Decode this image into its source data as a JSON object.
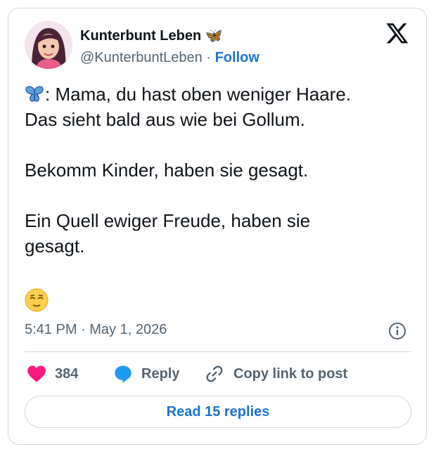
{
  "author": {
    "name": "Kunterbunt Leben 🦋",
    "handle": "@KunterbuntLeben",
    "follow_label": "Follow",
    "separator": "·"
  },
  "post": {
    "lines": [
      ": Mama, du hast oben weniger Haare.",
      "Das sieht bald aus wie bei Gollum.",
      "Bekomm Kinder, haben sie gesagt.",
      "Ein Quell ewiger Freude, haben sie",
      "gesagt."
    ],
    "prefix_icon": "butterfly-emoji",
    "emoji": "relieved-face-emoji",
    "timestamp": "5:41 PM · May 1, 2026"
  },
  "actions": {
    "likes_count": "384",
    "reply_label": "Reply",
    "copy_label": "Copy link to post"
  },
  "read_replies_label": "Read 15 replies",
  "colors": {
    "accent": "#1d72c9",
    "like": "#f91880",
    "muted": "#536471",
    "border": "#cfd9de",
    "text": "#0f1419"
  }
}
